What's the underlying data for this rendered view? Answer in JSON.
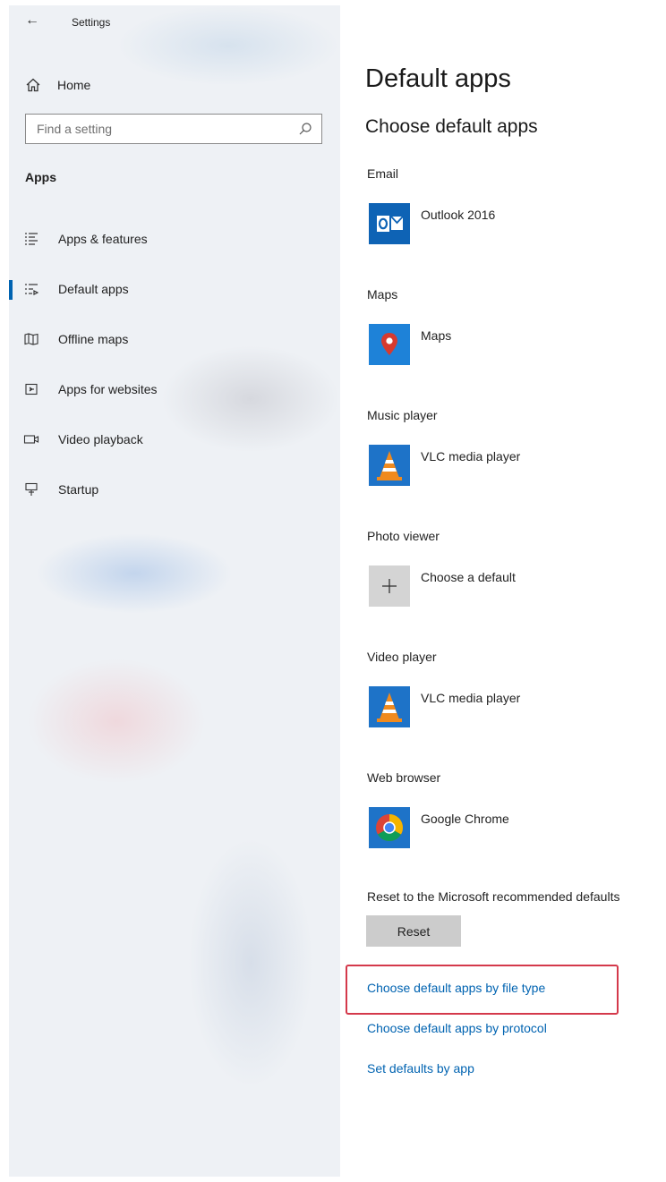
{
  "window": {
    "title": "Settings"
  },
  "sidebar": {
    "home_label": "Home",
    "search_placeholder": "Find a setting",
    "section_title": "Apps",
    "items": [
      {
        "label": "Apps & features",
        "icon": "apps-features-icon"
      },
      {
        "label": "Default apps",
        "icon": "default-apps-icon",
        "selected": true
      },
      {
        "label": "Offline maps",
        "icon": "offline-maps-icon"
      },
      {
        "label": "Apps for websites",
        "icon": "apps-for-websites-icon"
      },
      {
        "label": "Video playback",
        "icon": "video-playback-icon"
      },
      {
        "label": "Startup",
        "icon": "startup-icon"
      }
    ]
  },
  "main": {
    "title": "Default apps",
    "subtitle": "Choose default apps",
    "categories": [
      {
        "label": "Email",
        "app": "Outlook 2016",
        "icon": "outlook-icon"
      },
      {
        "label": "Maps",
        "app": "Maps",
        "icon": "maps-icon"
      },
      {
        "label": "Music player",
        "app": "VLC media player",
        "icon": "vlc-icon"
      },
      {
        "label": "Photo viewer",
        "app": "Choose a default",
        "icon": "plus-icon"
      },
      {
        "label": "Video player",
        "app": "VLC media player",
        "icon": "vlc-icon"
      },
      {
        "label": "Web browser",
        "app": "Google Chrome",
        "icon": "chrome-icon"
      }
    ],
    "reset_label": "Reset to the Microsoft recommended defaults",
    "reset_button": "Reset",
    "links": {
      "by_file_type": "Choose default apps by file type",
      "by_protocol": "Choose default apps by protocol",
      "by_app": "Set defaults by app"
    }
  },
  "colors": {
    "accent": "#0063b1",
    "highlight": "#d4394b",
    "sidebar_bg": "#eef1f5",
    "tile_blue": "#0078d7"
  }
}
